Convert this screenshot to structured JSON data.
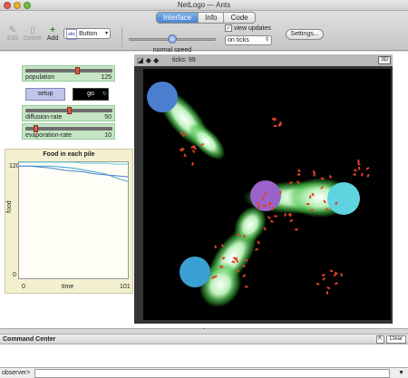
{
  "window": {
    "title": "NetLogo — Ants"
  },
  "tabs": [
    {
      "label": "Interface",
      "active": true
    },
    {
      "label": "Info",
      "active": false
    },
    {
      "label": "Code",
      "active": false
    }
  ],
  "toolbar": {
    "edit_label": "Edit",
    "delete_label": "Delete",
    "add_label": "Add",
    "widget_type": "Button",
    "widget_type_abbr": "abc",
    "speed_label": "normal speed",
    "speed_fraction": 0.5,
    "view_updates_label": "view updates",
    "view_updates_checked": true,
    "update_mode": "on ticks",
    "settings_label": "Settings..."
  },
  "sliders": [
    {
      "label": "population",
      "value": "125",
      "fraction": 0.6
    },
    {
      "label": "diffusion-rate",
      "value": "50",
      "fraction": 0.5
    },
    {
      "label": "evaporation-rate",
      "value": "10",
      "fraction": 0.1
    }
  ],
  "buttons": {
    "setup_label": "setup",
    "go_label": "go",
    "forever_glyph": "↻"
  },
  "view": {
    "ticks_label": "ticks:",
    "ticks_value": "99",
    "threed_label": "3D",
    "controls_glyph": "◪ ◆ ◆",
    "background": "#000000",
    "nest_color": "#9a63c9",
    "food_colors": [
      "#4a7fcf",
      "#3aa0d4",
      "#5ed4e0"
    ],
    "ant_color": "#e0412c",
    "pheromone_color": "#40c040"
  },
  "plot": {
    "title": "Food in each pile",
    "ylabel": "food",
    "xlabel": "time",
    "y_max": "120",
    "y_min": "0",
    "x_min": "0",
    "x_max": "101"
  },
  "chart_data": {
    "type": "line",
    "title": "Food in each pile",
    "xlabel": "time",
    "ylabel": "food",
    "xlim": [
      0,
      101
    ],
    "ylim": [
      0,
      120
    ],
    "x": [
      0,
      10,
      20,
      30,
      40,
      50,
      60,
      70,
      80,
      90,
      101
    ],
    "series": [
      {
        "color": "#3aa0d4",
        "values": [
          116,
          116,
          116,
          116,
          115,
          114,
          112,
          110,
          108,
          104,
          100
        ]
      },
      {
        "color": "#4a7fcf",
        "values": [
          116,
          116,
          115,
          114,
          112,
          111,
          110,
          108,
          107,
          106,
          105
        ]
      },
      {
        "color": "#5ed4e0",
        "values": [
          120,
          120,
          120,
          120,
          120,
          120,
          119,
          119,
          119,
          118,
          118
        ]
      }
    ]
  },
  "command_center": {
    "title": "Command Center",
    "clear_label": "Clear",
    "observer_label": "observer>",
    "input_value": ""
  }
}
